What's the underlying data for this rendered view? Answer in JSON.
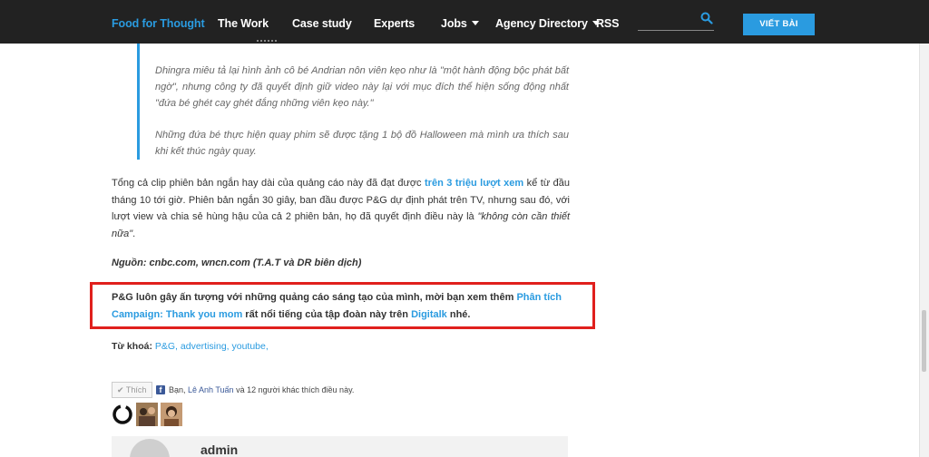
{
  "nav": {
    "brand": "Food for Thought",
    "items": [
      {
        "label": "The Work"
      },
      {
        "label": "Case study"
      },
      {
        "label": "Experts"
      },
      {
        "label": "Jobs"
      },
      {
        "label": "Agency Directory"
      },
      {
        "label": "RSS"
      }
    ],
    "write_button": "VIẾT BÀI"
  },
  "quote": {
    "p1": "Dhingra miêu tả lại hình ảnh cô bé Andrian nôn viên kẹo như là \"một hành động bộc phát bất ngờ\", nhưng công ty đã quyết định giữ video này lại với mục đích thể hiện sống động nhất \"đứa bé ghét cay ghét đắng những viên kẹo này.\"",
    "p2": "Những đứa bé thực hiện quay phim sẽ được tặng 1 bộ đồ Halloween mà mình ưa thích sau khi kết thúc ngày quay."
  },
  "body": {
    "p1_before": "Tổng cả clip phiên bản ngắn hay dài của quảng cáo này đã đạt được ",
    "p1_link": "trên 3 triệu lượt xem",
    "p1_after": " kể từ đầu tháng 10 tới giờ. Phiên bản ngắn 30 giây, ban đầu được P&G dự định phát trên TV, nhưng sau đó, với lượt view và chia sẻ hùng hậu của cả 2 phiên bản, họ đã quyết định điều này là ",
    "p1_italic": "\"không còn cần thiết nữa\"",
    "p1_end": ".",
    "source": "Nguồn: cnbc.com, wncn.com (T.A.T và DR biên dịch)"
  },
  "promo": {
    "before": "P&G luôn gây ấn tượng với những quảng cáo sáng tạo của mình, mời bạn xem thêm ",
    "link1": "Phân tích Campaign: Thank you mom",
    "middle": " rất nổi tiếng của tập đoàn này trên ",
    "link2": "Digitalk",
    "after": " nhé."
  },
  "tags": {
    "label": "Từ khoá:",
    "list": "P&G, advertising, youtube,"
  },
  "facebook": {
    "like_label": "Thích",
    "icon_letter": "f",
    "before": "Bạn, ",
    "friend": "Lê Anh Tuấn",
    "after": " và 12 người khác thích điều này."
  },
  "author": {
    "name": "admin"
  }
}
